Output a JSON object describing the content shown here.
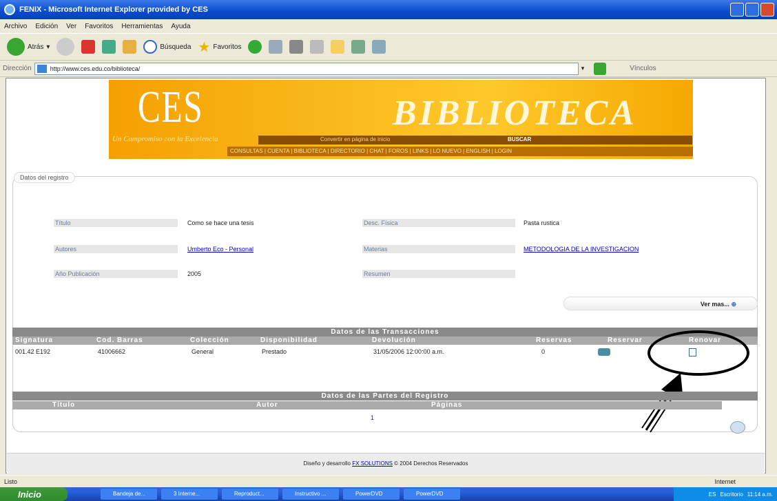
{
  "window": {
    "title": "FENIX - Microsoft Internet Explorer provided by CES"
  },
  "menu": [
    "Archivo",
    "Edición",
    "Ver",
    "Favoritos",
    "Herramientas",
    "Ayuda"
  ],
  "toolbar": {
    "back": "Atrás",
    "search": "Búsqueda",
    "favorites": "Favoritos"
  },
  "address": {
    "label": "Dirección",
    "url": "http://www.ces.edu.co/biblioteca/",
    "links": "Vínculos"
  },
  "banner": {
    "ces": "CES",
    "biblioteca": "BIBLIOTECA",
    "slogan": "Un Compromiso con la Excelencia",
    "home": "Convertir en página de inicio",
    "buscar": "BUSCAR",
    "nav": "CONSULTAS | CUENTA | BIBLIOTECA | DIRECTORIO | CHAT | FOROS | LINKS | LO NUEVO | ENGLISH | LOGIN"
  },
  "record": {
    "legend": "Datos del registro",
    "titulo_label": "Título",
    "titulo": "Como se hace una tesis",
    "autores_label": "Autores",
    "autores": "Umberto Eco - Personal",
    "anio_label": "Año Publicación",
    "anio": "2005",
    "desc_label": "Desc. Física",
    "desc": "Pasta rustica",
    "materias_label": "Materias",
    "materias": "METODOLOGIA DE LA INVESTIGACION",
    "resumen_label": "Resumen",
    "ver_mas": "Ver mas..."
  },
  "transactions": {
    "title": "Datos de las Transacciones",
    "headers": [
      "Signatura",
      "Cod. Barras",
      "Colección",
      "Disponibilidad",
      "Devolución",
      "Reservas",
      "Reservar",
      "Renovar"
    ],
    "row": [
      "001.42 E192",
      "41006662",
      "General",
      "Prestado",
      "31/05/2006 12:00:00 a.m.",
      "0"
    ]
  },
  "parts": {
    "title": "Datos de las Partes del Registro",
    "headers": [
      "Título",
      "Autor",
      "Páginas"
    ],
    "page": "1"
  },
  "footer": {
    "text": "Diseño y desarrollo",
    "company": "FX SOLUTIONS",
    "copyright": "© 2004 Derechos Reservados"
  },
  "status": {
    "left": "Listo",
    "zone": "Internet"
  },
  "taskbar": {
    "start": "Inicio",
    "tasks": [
      "Bandeja de...",
      "3 Interne...",
      "Reproduct...",
      "Instructivo ...",
      "PowerDVD",
      "PowerDVD"
    ],
    "lang": "ES",
    "desk": "Escritorio",
    "time": "11:14 a.m."
  }
}
